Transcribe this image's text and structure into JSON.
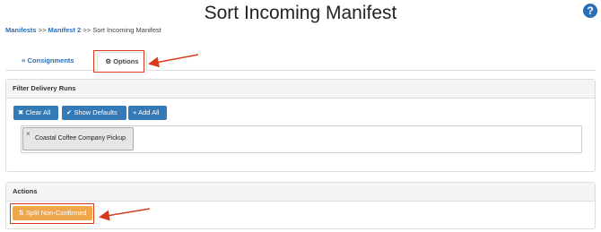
{
  "page": {
    "title": "Sort Incoming Manifest",
    "help_icon": "question-circle-icon",
    "help_glyph": "?"
  },
  "breadcrumb": {
    "item1": "Manifests",
    "sep1": ">>",
    "item2": "Manifest 2",
    "sep2": ">>",
    "current": "Sort Incoming Manifest"
  },
  "tabs": [
    {
      "icon": "list-icon",
      "icon_glyph": "≡",
      "label": "Consignments"
    },
    {
      "icon": "gear-icon",
      "icon_glyph": "⚙",
      "label": "Options"
    }
  ],
  "filter_panel": {
    "title": "Filter Delivery Runs",
    "buttons": [
      {
        "icon": "close-icon",
        "icon_glyph": "✖",
        "label": "Clear All"
      },
      {
        "icon": "check-icon",
        "icon_glyph": "✔",
        "label": "Show Defaults"
      },
      {
        "icon": "plus-icon",
        "icon_glyph": "+",
        "label": "Add All"
      }
    ],
    "selected": [
      {
        "remove_glyph": "×",
        "label": "Coastal Coffee Company Pickup"
      }
    ]
  },
  "actions_panel": {
    "title": "Actions",
    "button": {
      "icon": "split-icon",
      "icon_glyph": "⇅",
      "label": "Split Non-Confirmed"
    }
  },
  "colors": {
    "primary": "#337ab7",
    "warning": "#f0a64a",
    "annotation": "#d83a1e"
  }
}
